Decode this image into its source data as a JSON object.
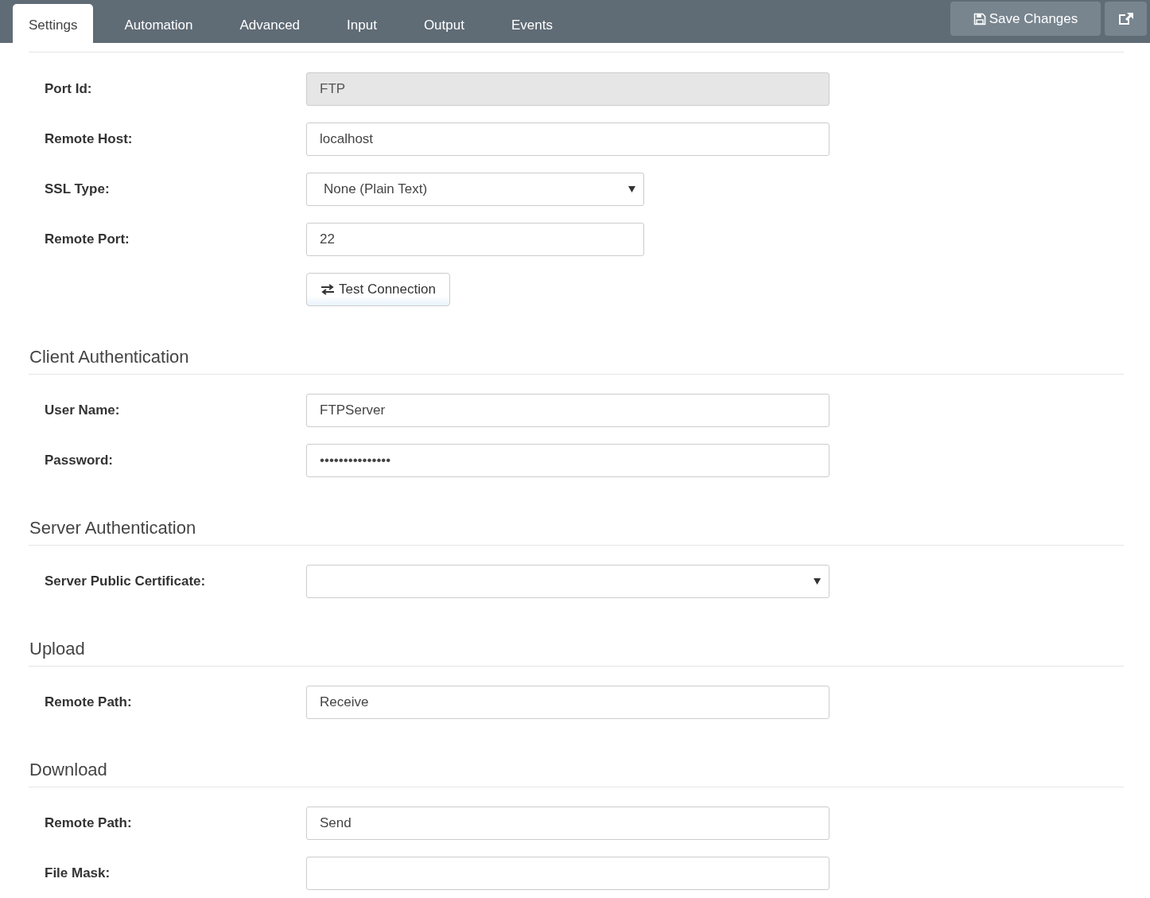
{
  "tabs": [
    {
      "label": "Settings",
      "selected": true
    },
    {
      "label": "Automation",
      "selected": false
    },
    {
      "label": "Advanced",
      "selected": false
    },
    {
      "label": "Input",
      "selected": false
    },
    {
      "label": "Output",
      "selected": false
    },
    {
      "label": "Events",
      "selected": false
    }
  ],
  "toolbar": {
    "save_button": "Save Changes"
  },
  "sections": [
    {
      "fields": [
        {
          "kind": "text",
          "label": "Port Id:",
          "value": "FTP",
          "disabled": true,
          "short": false
        },
        {
          "kind": "text",
          "label": "Remote Host:",
          "value": "localhost",
          "disabled": false,
          "short": false
        },
        {
          "kind": "select",
          "label": "SSL Type:",
          "value": "None (Plain Text)",
          "disabled": false,
          "short": true
        },
        {
          "kind": "text",
          "label": "Remote Port:",
          "value": "22",
          "disabled": false,
          "short": true
        },
        {
          "kind": "button",
          "value": "Test Connection"
        }
      ]
    },
    {
      "title": "Client Authentication",
      "fields": [
        {
          "kind": "text",
          "label": "User Name:",
          "value": "FTPServer",
          "disabled": false,
          "short": false
        },
        {
          "kind": "text",
          "label": "Password:",
          "value": "•••••••••••••••",
          "disabled": false,
          "short": false
        }
      ]
    },
    {
      "title": "Server Authentication",
      "fields": [
        {
          "kind": "select",
          "label": "Server Public Certificate:",
          "disabled": false,
          "short": false
        }
      ]
    },
    {
      "title": "Upload",
      "fields": [
        {
          "kind": "text",
          "label": "Remote Path:",
          "value": "Receive",
          "disabled": false,
          "short": false
        }
      ]
    },
    {
      "title": "Download",
      "fields": [
        {
          "kind": "text",
          "label": "Remote Path:",
          "value": "Send",
          "disabled": false,
          "short": false
        },
        {
          "kind": "text",
          "label": "File Mask:",
          "disabled": false,
          "short": false
        }
      ]
    }
  ]
}
